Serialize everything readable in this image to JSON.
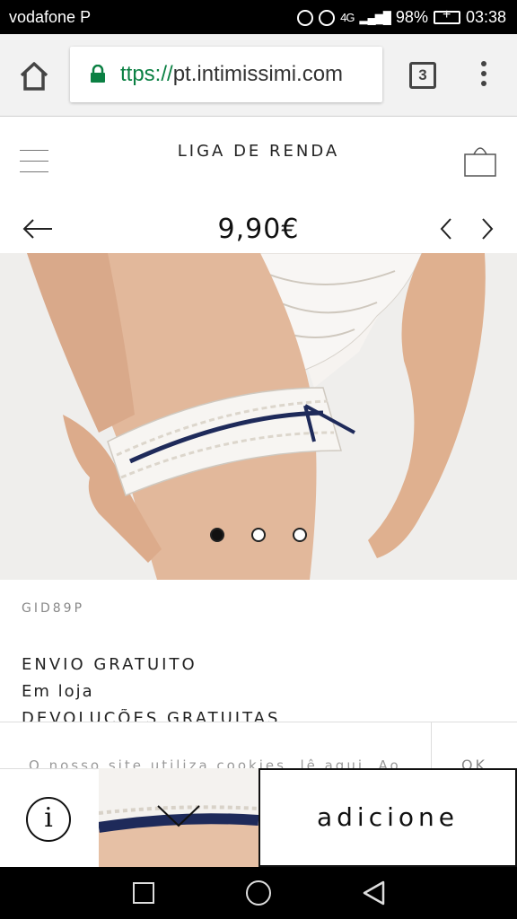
{
  "status_bar": {
    "carrier": "vodafone P",
    "network": "4G",
    "battery": "98%",
    "time": "03:38"
  },
  "browser": {
    "url_scheme": "ttps://",
    "url_host": "pt.intimissimi.com",
    "tab_count": "3"
  },
  "header": {
    "title": "LIGA DE RENDA"
  },
  "product": {
    "price": "9,90€",
    "sku": "GID89P",
    "shipping_title": "ENVIO GRATUITO",
    "shipping_sub": "Em loja",
    "returns": "DEVOLUÇÕES GRATUITAS",
    "carousel": {
      "count": 3,
      "active_index": 0
    }
  },
  "cookie": {
    "text": "O nosso site utiliza cookies, lê aqui. Ao",
    "ok_label": "OK"
  },
  "action_bar": {
    "add_label": "adicione",
    "info_symbol": "i"
  },
  "colors": {
    "status_bar": "#000000",
    "secure_scheme": "#0b8043",
    "page_bg": "#ffffff",
    "photo_bg": "#efeeec",
    "garter_ribbon": "#1e2a5a"
  }
}
